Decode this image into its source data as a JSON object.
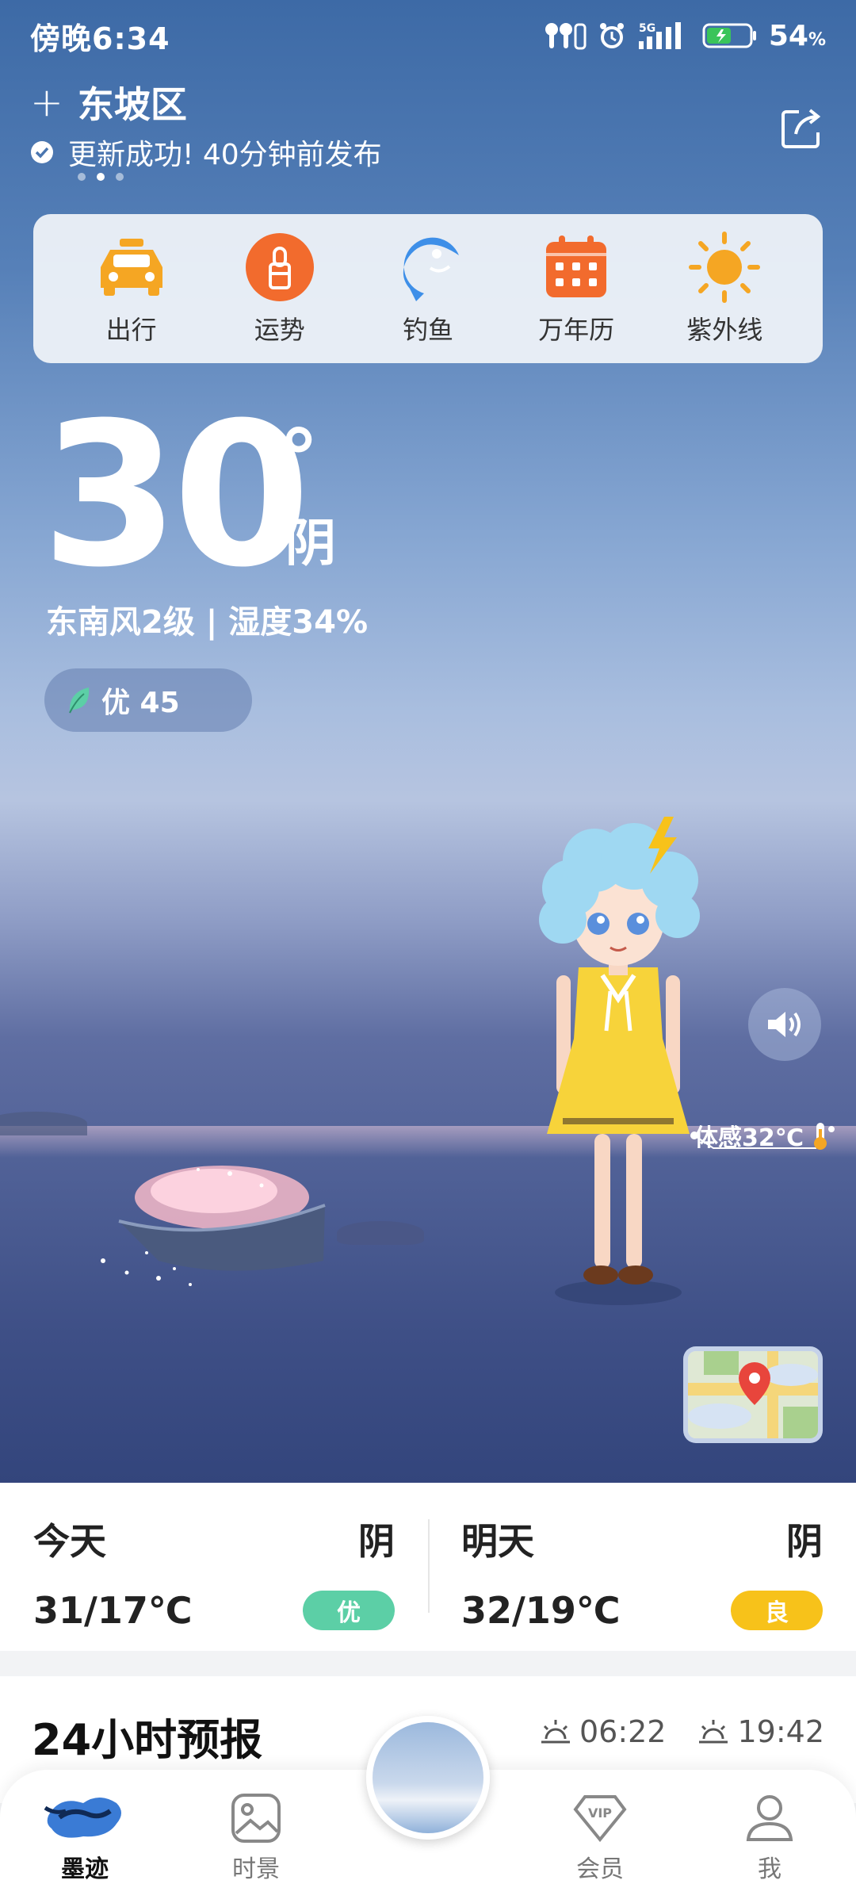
{
  "status_bar": {
    "time": "傍晚6:34",
    "battery": "54",
    "battery_unit": "%",
    "network": "5G"
  },
  "header": {
    "add_symbol": "+",
    "location": "东坡区",
    "update_status": "更新成功! 40分钟前发布"
  },
  "shortcuts": [
    {
      "label": "出行",
      "icon": "taxi-icon",
      "color": "#f5a623"
    },
    {
      "label": "运势",
      "icon": "fortune-icon",
      "color": "#f26b2d"
    },
    {
      "label": "钓鱼",
      "icon": "fish-icon",
      "color": "#3e8fe8"
    },
    {
      "label": "万年历",
      "icon": "calendar-icon",
      "color": "#f26b2d"
    },
    {
      "label": "紫外线",
      "icon": "sun-icon",
      "color": "#f5a623"
    }
  ],
  "current": {
    "temperature": "30",
    "degree_symbol": "°",
    "condition": "阴",
    "wind_humidity": "东南风2级 | 湿度34%",
    "aqi_label": "优 45",
    "feels_like": "体感32℃"
  },
  "days": [
    {
      "name": "今天",
      "condition": "阴",
      "temp": "31/17℃",
      "aqi": "优",
      "aqi_color": "#5ccfa6"
    },
    {
      "name": "明天",
      "condition": "阴",
      "temp": "32/19℃",
      "aqi": "良",
      "aqi_color": "#f7c21a"
    }
  ],
  "forecast": {
    "title": "24小时预报",
    "sunrise": "06:22",
    "sunset": "19:42"
  },
  "nav": {
    "items": [
      {
        "label": "墨迹",
        "icon": "moji-logo-icon"
      },
      {
        "label": "时景",
        "icon": "image-icon"
      },
      {
        "label": "会员",
        "icon": "vip-icon"
      },
      {
        "label": "我",
        "icon": "user-icon"
      }
    ],
    "vip_text": "VIP"
  },
  "colors": {
    "accent_orange": "#f26b2d",
    "accent_blue": "#3e8fe8"
  }
}
